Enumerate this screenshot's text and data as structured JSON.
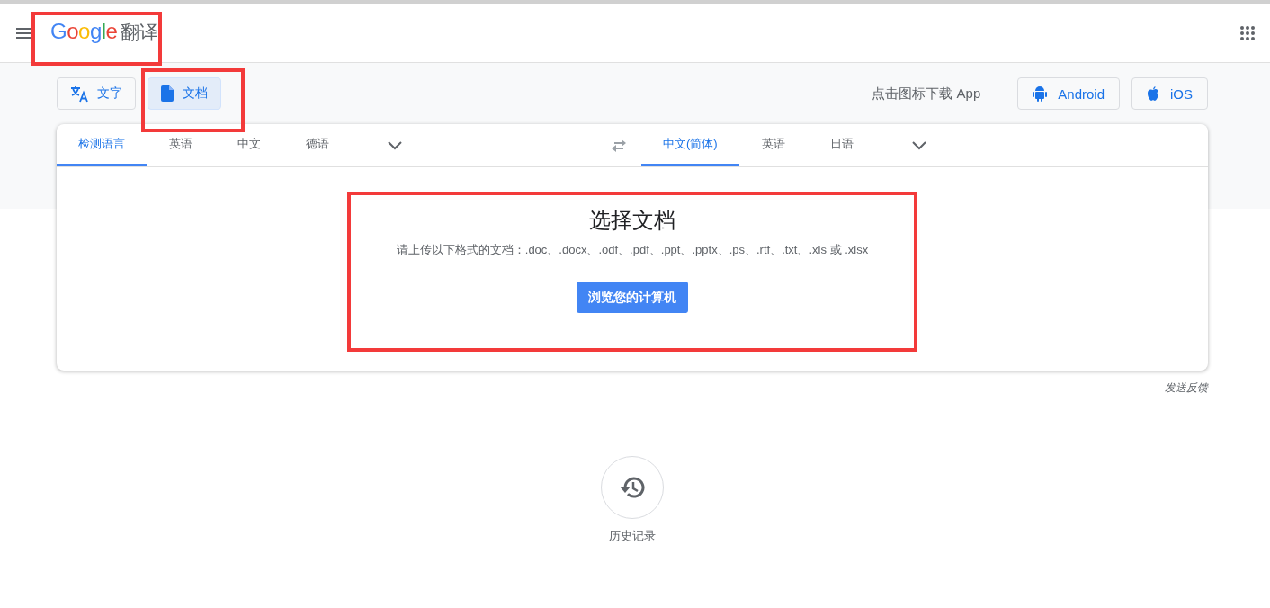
{
  "header": {
    "logo": {
      "text": "Google",
      "suffix": "翻译",
      "highlighted": true
    }
  },
  "modes": [
    {
      "label": "文字",
      "kind": "text",
      "selected": false,
      "highlighted": false
    },
    {
      "label": "文档",
      "kind": "document",
      "selected": true,
      "highlighted": true
    }
  ],
  "app_download": {
    "prompt": "点击图标下载 App",
    "buttons": [
      {
        "label": "Android",
        "kind": "android"
      },
      {
        "label": "iOS",
        "kind": "ios"
      }
    ]
  },
  "source_languages": [
    {
      "label": "检测语言",
      "selected": true
    },
    {
      "label": "英语",
      "selected": false
    },
    {
      "label": "中文",
      "selected": false
    },
    {
      "label": "德语",
      "selected": false
    }
  ],
  "target_languages": [
    {
      "label": "中文(简体)",
      "selected": true
    },
    {
      "label": "英语",
      "selected": false
    },
    {
      "label": "日语",
      "selected": false
    }
  ],
  "upload": {
    "title": "选择文档",
    "description": "请上传以下格式的文档：.doc、.docx、.odf、.pdf、.ppt、.pptx、.ps、.rtf、.txt、.xls 或 .xlsx",
    "button": "浏览您的计算机",
    "highlighted": true
  },
  "feedback": "发送反馈",
  "history": {
    "label": "历史记录"
  }
}
